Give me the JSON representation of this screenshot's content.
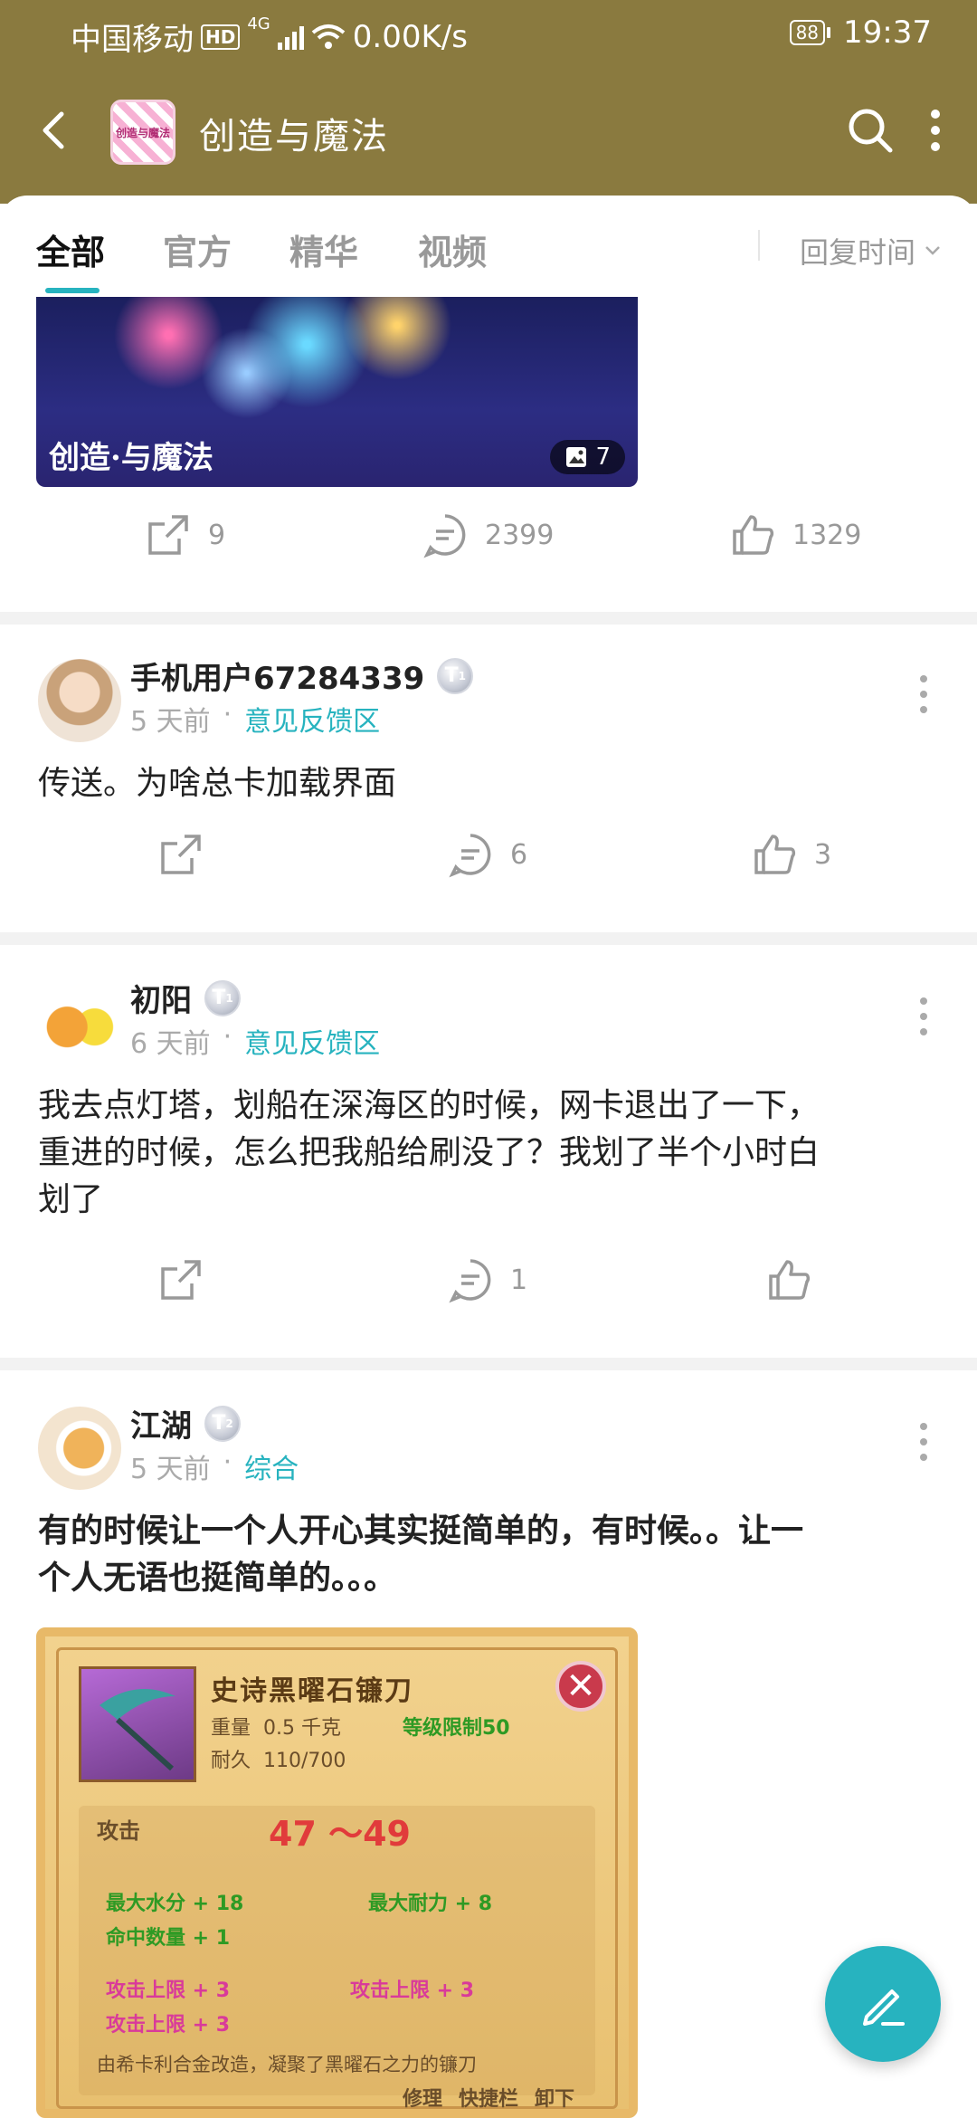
{
  "status_bar": {
    "carrier": "中国移动",
    "hd": "HD",
    "network": "4G",
    "speed": "0.00K/s",
    "battery": "88",
    "time": "19:37"
  },
  "header": {
    "title": "创造与魔法",
    "logo_text": "创造与魔法"
  },
  "tabs": {
    "items": [
      "全部",
      "官方",
      "精华",
      "视频"
    ],
    "sort_label": "回复时间"
  },
  "posts": [
    {
      "image_logo": "创造·与魔法",
      "image_count": "7",
      "share": "9",
      "comments": "2399",
      "likes": "1329"
    },
    {
      "user": "手机用户67284339",
      "level": "1",
      "time": "5 天前",
      "category": "意见反馈区",
      "text": "传送。为啥总卡加载界面",
      "comments": "6",
      "likes": "3"
    },
    {
      "user": "初阳",
      "level": "1",
      "time": "6 天前",
      "category": "意见反馈区",
      "text_line1": "我去点灯塔，划船在深海区的时候，网卡退出了一下，",
      "text_line2": "重进的时候，怎么把我船给刷没了？我划了半个小时白",
      "text_line3": "划了",
      "comments": "1"
    },
    {
      "user": "江湖",
      "level": "2",
      "time": "5 天前",
      "category": "综合",
      "text_line1": "有的时候让一个人开心其实挺简单的，有时候。。让一",
      "text_line2": "个人无语也挺简单的。。。",
      "item_card": {
        "name": "史诗黑曜石镰刀",
        "weight_label": "重量",
        "weight_value": "0.5 千克",
        "level_limit": "等级限制50",
        "durability_label": "耐久",
        "durability_value": "110/700",
        "attack_label": "攻击",
        "attack_value": "47 ～49",
        "stat1": "最大水分 + 18",
        "stat2": "最大耐力 + 8",
        "stat3": "命中数量 + 1",
        "stat4": "攻击上限 + 3",
        "stat5": "攻击上限 + 3",
        "stat6": "攻击上限 + 3",
        "desc": "由希卡利合金改造，凝聚了黑曜石之力的镰刀",
        "btn_repair": "修理",
        "btn_shortcut": "快捷栏",
        "btn_unequip": "卸下"
      }
    }
  ],
  "colors": {
    "header_bg": "#8a7a3f",
    "accent": "#27b3bf"
  }
}
